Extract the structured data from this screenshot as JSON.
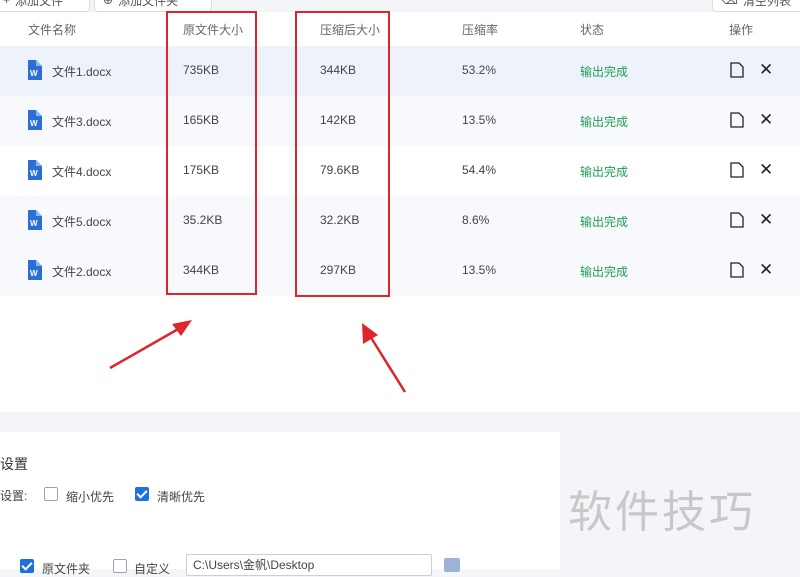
{
  "toolbar": {
    "add_file_label": "添加文件",
    "add_folder_label": "添加文件夹",
    "clear_list_label": "清空列表"
  },
  "table": {
    "columns": [
      "文件名称",
      "原文件大小",
      "压缩后大小",
      "压缩率",
      "状态",
      "操作"
    ],
    "rows": [
      {
        "name": "文件1.docx",
        "orig": "735KB",
        "comp": "344KB",
        "ratio": "53.2%",
        "status": "输出完成"
      },
      {
        "name": "文件3.docx",
        "orig": "165KB",
        "comp": "142KB",
        "ratio": "13.5%",
        "status": "输出完成"
      },
      {
        "name": "文件4.docx",
        "orig": "175KB",
        "comp": "79.6KB",
        "ratio": "54.4%",
        "status": "输出完成"
      },
      {
        "name": "文件5.docx",
        "orig": "35.2KB",
        "comp": "32.2KB",
        "ratio": "8.6%",
        "status": "输出完成"
      },
      {
        "name": "文件2.docx",
        "orig": "344KB",
        "comp": "297KB",
        "ratio": "13.5%",
        "status": "输出完成"
      }
    ]
  },
  "settings": {
    "title": "设置",
    "mode_label": "设置:",
    "option_small": "缩小优先",
    "option_clear": "清晰优先",
    "output_original": "原文件夹",
    "output_custom": "自定义",
    "path_value": "C:\\Users\\金帆\\Desktop"
  },
  "watermark": "软件技巧",
  "colors": {
    "highlight": "#e0242b",
    "status": "#1f9d55",
    "accent": "#1e6fe0"
  }
}
